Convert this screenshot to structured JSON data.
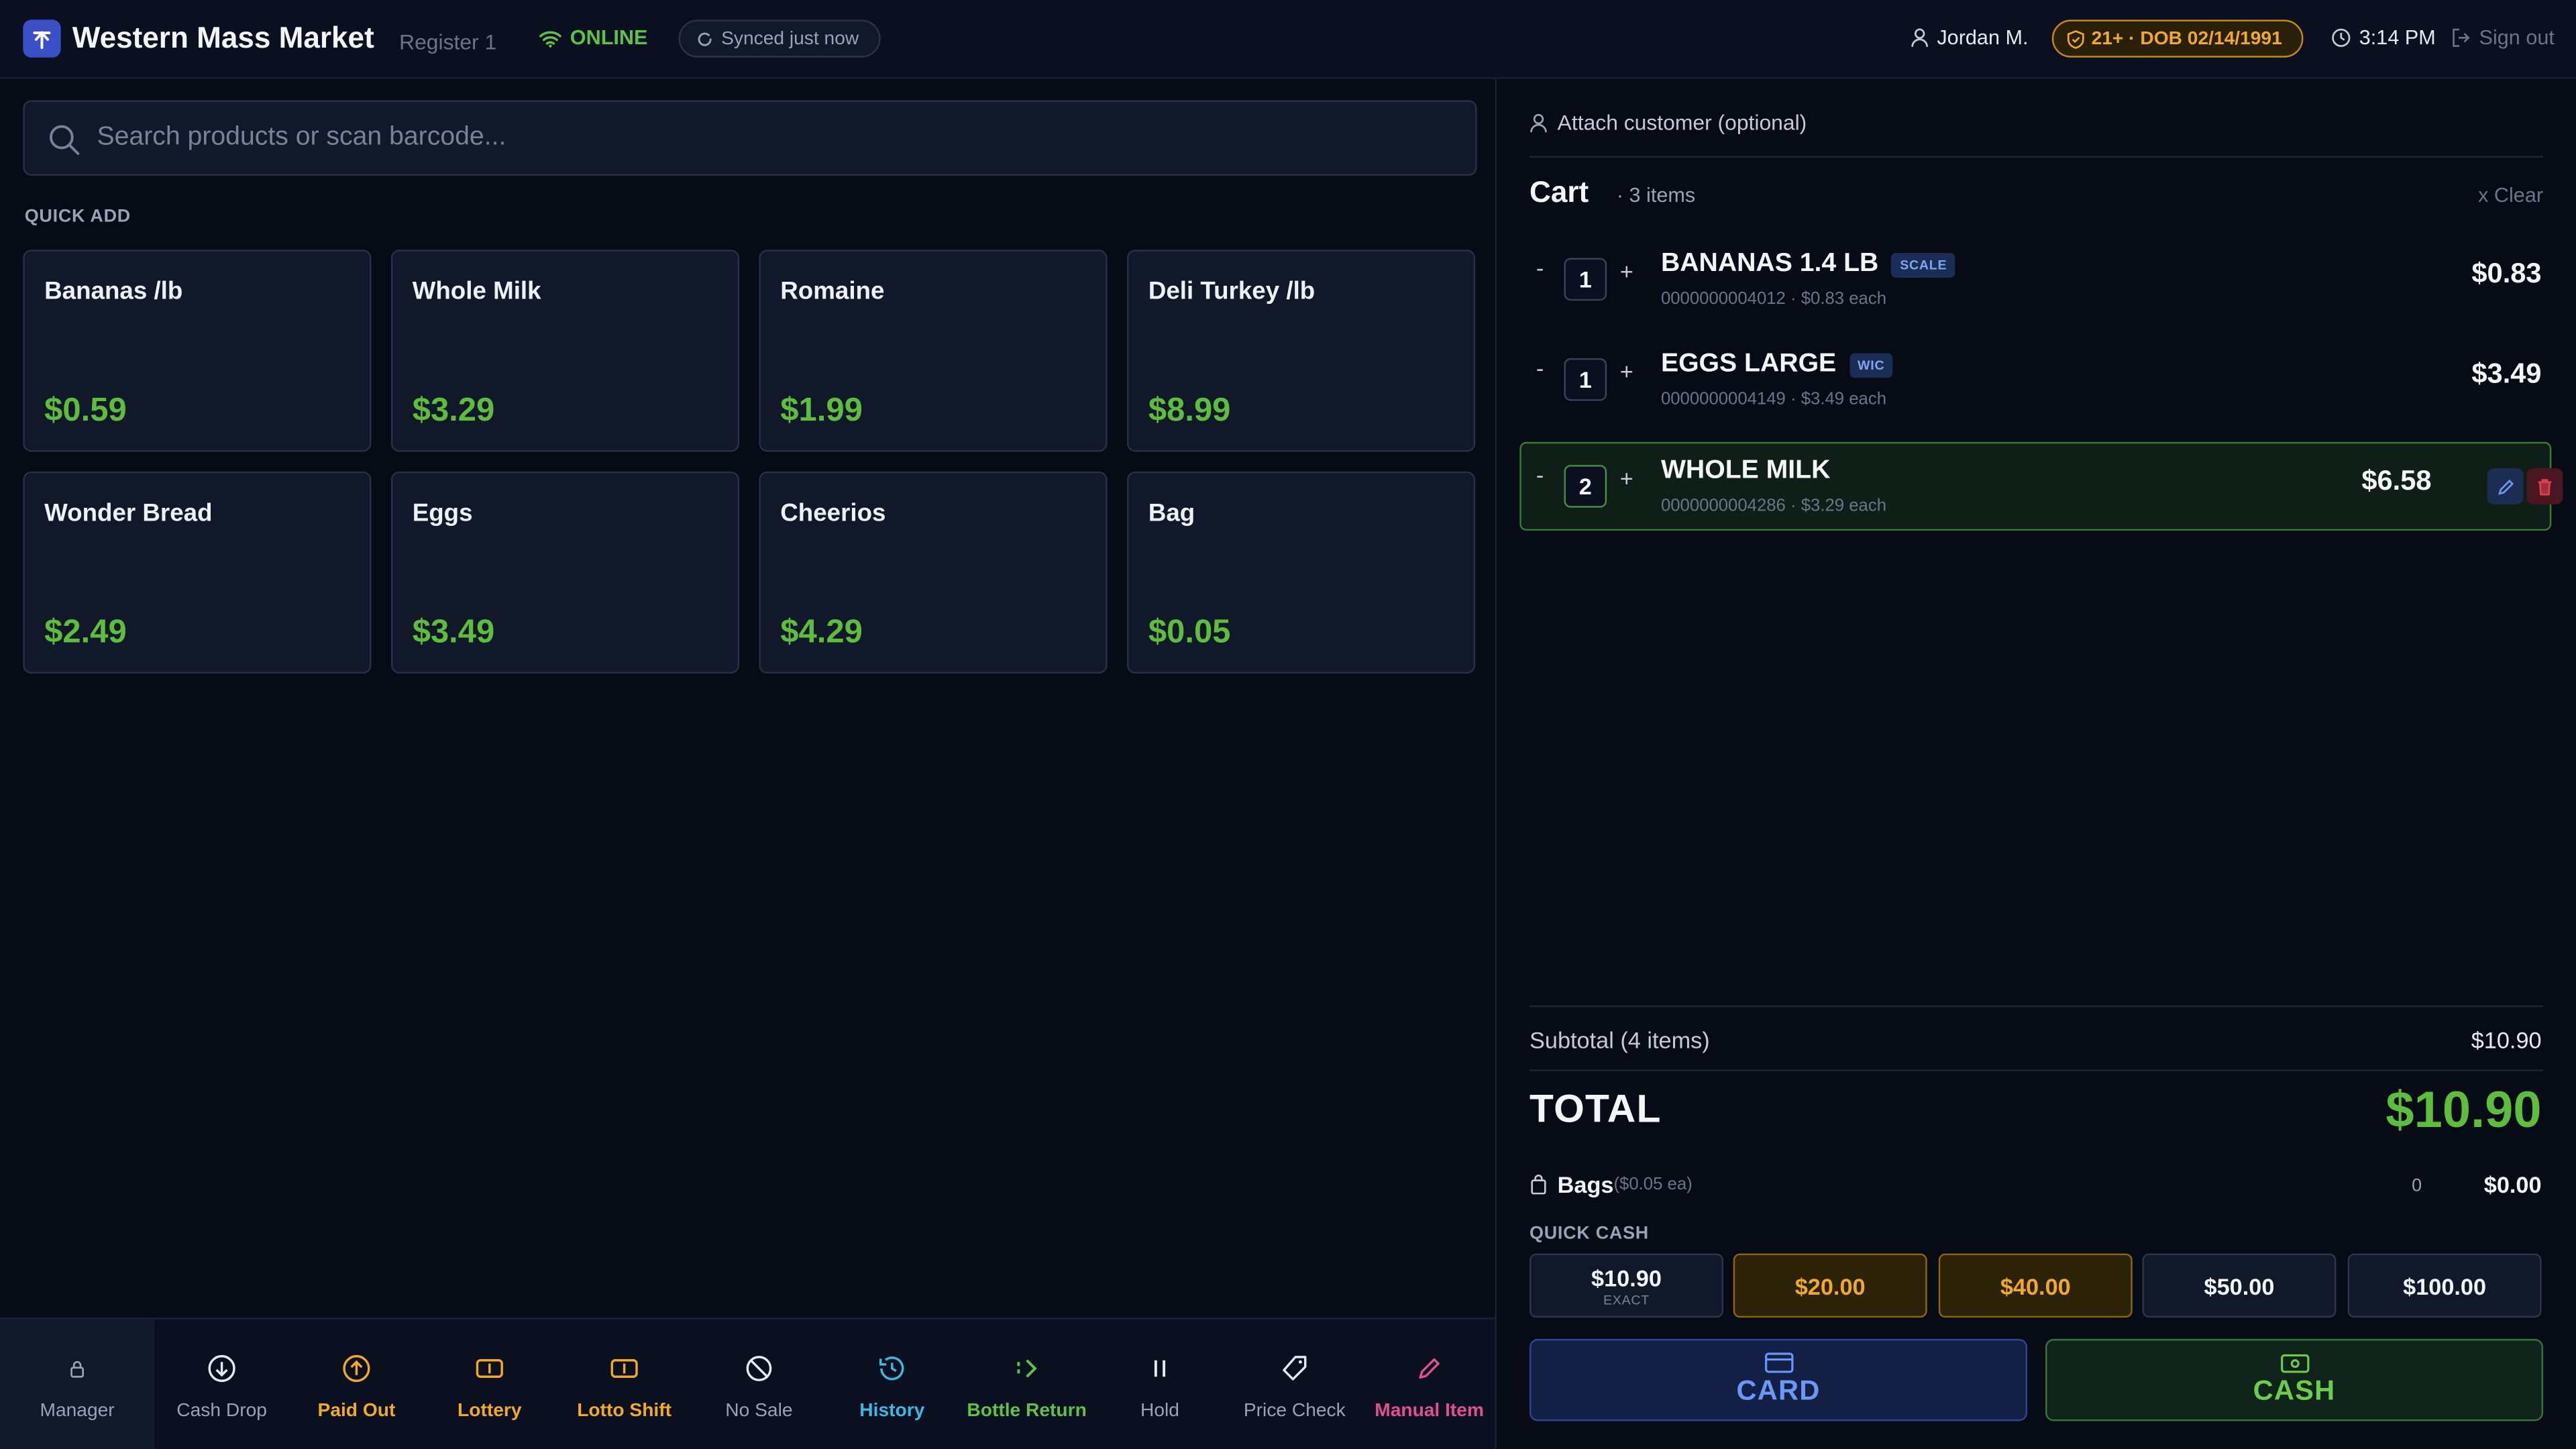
{
  "header": {
    "app_title": "Western Mass Market",
    "register": "Register 1",
    "status": "ONLINE",
    "sync": "Synced just now",
    "user": "Jordan M.",
    "age_badge": "21+ · DOB 02/14/1991",
    "time": "3:14 PM",
    "signout": "Sign out"
  },
  "search": {
    "placeholder": "Search products or scan barcode..."
  },
  "quick_add": {
    "label": "QUICK ADD",
    "tiles": [
      {
        "name": "Bananas /lb",
        "price": "$0.59"
      },
      {
        "name": "Whole Milk",
        "price": "$3.29"
      },
      {
        "name": "Romaine",
        "price": "$1.99"
      },
      {
        "name": "Deli Turkey /lb",
        "price": "$8.99"
      },
      {
        "name": "Wonder Bread",
        "price": "$2.49"
      },
      {
        "name": "Eggs",
        "price": "$3.49"
      },
      {
        "name": "Cheerios",
        "price": "$4.29"
      },
      {
        "name": "Bag",
        "price": "$0.05"
      }
    ]
  },
  "toolbar": [
    {
      "label": "Manager",
      "icon": "lock-icon",
      "color": "#9aa2b5"
    },
    {
      "label": "Cash Drop",
      "icon": "arrow-down-circle-icon",
      "color": "#9aa2b5"
    },
    {
      "label": "Paid Out",
      "icon": "arrow-up-circle-icon",
      "color": "#f0a92a"
    },
    {
      "label": "Lottery",
      "icon": "ticket-icon",
      "color": "#f0a92a"
    },
    {
      "label": "Lotto Shift",
      "icon": "ticket-icon",
      "color": "#f0a92a"
    },
    {
      "label": "No Sale",
      "icon": "ban-icon",
      "color": "#9aa2b5"
    },
    {
      "label": "History",
      "icon": "history-icon",
      "color": "#3fb7e0"
    },
    {
      "label": "Bottle Return",
      "icon": "recycle-icon",
      "color": "#5fc04a"
    },
    {
      "label": "Hold",
      "icon": "pause-icon",
      "color": "#9aa2b5"
    },
    {
      "label": "Price Check",
      "icon": "tag-icon",
      "color": "#9aa2b5"
    },
    {
      "label": "Manual Item",
      "icon": "pencil-icon",
      "color": "#e0508f"
    }
  ],
  "cart": {
    "attach": "Attach customer (optional)",
    "title": "Cart",
    "count": "· 3 items",
    "clear": "x Clear",
    "items": [
      {
        "qty": "1",
        "name": "BANANAS 1.4 LB",
        "badge": "SCALE",
        "code": "0000000004012",
        "each": "$0.83 each",
        "price": "$0.83"
      },
      {
        "qty": "1",
        "name": "EGGS LARGE",
        "badge": "WIC",
        "code": "0000000004149",
        "each": "$3.49 each",
        "price": "$3.49"
      },
      {
        "qty": "2",
        "name": "WHOLE MILK",
        "badge": "",
        "code": "0000000004286",
        "each": "$3.29 each",
        "price": "$6.58"
      }
    ]
  },
  "totals": {
    "subtotal_label": "Subtotal (4 items)",
    "subtotal": "$10.90",
    "total_label": "TOTAL",
    "total": "$10.90",
    "bags_label": "Bags",
    "bags_rate": "($0.05 ea)",
    "bags_count": "0",
    "bags_amount": "$0.00"
  },
  "quick_cash": {
    "label": "QUICK CASH",
    "buttons": [
      {
        "value": "$10.90",
        "sub": "EXACT"
      },
      {
        "value": "$20.00",
        "sub": ""
      },
      {
        "value": "$40.00",
        "sub": ""
      },
      {
        "value": "$50.00",
        "sub": ""
      },
      {
        "value": "$100.00",
        "sub": ""
      }
    ]
  },
  "payment": {
    "card": "CARD",
    "cash": "CASH"
  },
  "colors": {
    "accent_green": "#5fbd3e",
    "accent_gold": "#f0a92a",
    "accent_blue": "#6b98f5",
    "background": "#070b16"
  }
}
